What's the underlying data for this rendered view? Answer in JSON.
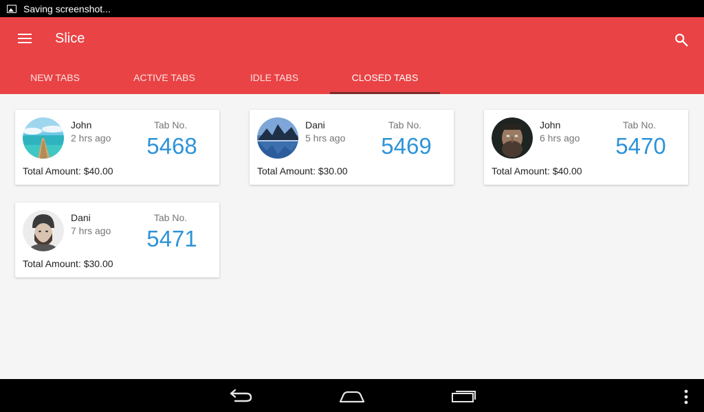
{
  "status_bar": {
    "notification_text": "Saving screenshot..."
  },
  "app": {
    "title": "Slice"
  },
  "tabs": [
    {
      "label": "NEW TABS"
    },
    {
      "label": "ACTIVE TABS"
    },
    {
      "label": "IDLE TABS"
    },
    {
      "label": "CLOSED TABS",
      "active": true
    }
  ],
  "cards": [
    {
      "name": "John",
      "time": "2 hrs ago",
      "tab_label": "Tab No.",
      "tab_number": "5468",
      "total": "Total Amount: $40.00",
      "avatar": "beach-pier-photo"
    },
    {
      "name": "Dani",
      "time": "5 hrs ago",
      "tab_label": "Tab No.",
      "tab_number": "5469",
      "total": "Total Amount: $30.00",
      "avatar": "mountain-lake-photo"
    },
    {
      "name": "John",
      "time": "6 hrs ago",
      "tab_label": "Tab No.",
      "tab_number": "5470",
      "total": "Total Amount: $40.00",
      "avatar": "bearded-man-photo"
    },
    {
      "name": "Dani",
      "time": "7 hrs ago",
      "tab_label": "Tab No.",
      "tab_number": "5471",
      "total": "Total Amount: $30.00",
      "avatar": "man-in-beanie-photo"
    }
  ],
  "colors": {
    "primary": "#e94345",
    "accent_number": "#2e93d8",
    "indicator": "#7a2b2c"
  },
  "icons": {
    "menu": "hamburger-menu-icon",
    "search": "search-icon",
    "back": "back-icon",
    "home": "home-icon",
    "recents": "recents-icon",
    "overflow": "overflow-menu-icon"
  }
}
